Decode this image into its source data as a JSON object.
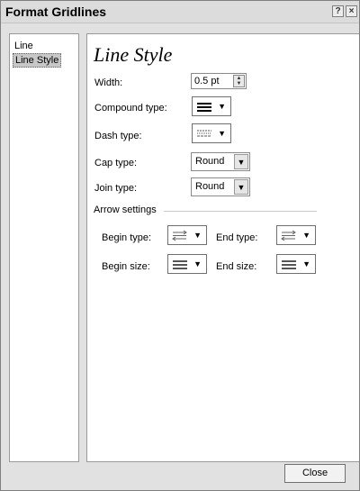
{
  "window": {
    "title": "Format Gridlines",
    "help_glyph": "?",
    "close_glyph": "×"
  },
  "nav": {
    "items": [
      {
        "label": "Line"
      },
      {
        "label": "Line Style"
      }
    ],
    "selected": "Line Style"
  },
  "panel": {
    "heading": "Line Style",
    "width": {
      "label": "Width:",
      "value": "0.5 pt"
    },
    "compound_type": {
      "label": "Compound type:"
    },
    "dash_type": {
      "label": "Dash type:"
    },
    "cap_type": {
      "label": "Cap type:",
      "value": "Round"
    },
    "join_type": {
      "label": "Join type:",
      "value": "Round"
    },
    "arrow_settings": {
      "label": "Arrow settings",
      "begin_type": {
        "label": "Begin type:"
      },
      "end_type": {
        "label": "End type:"
      },
      "begin_size": {
        "label": "Begin size:"
      },
      "end_size": {
        "label": "End size:"
      }
    }
  },
  "footer": {
    "close_label": "Close"
  }
}
